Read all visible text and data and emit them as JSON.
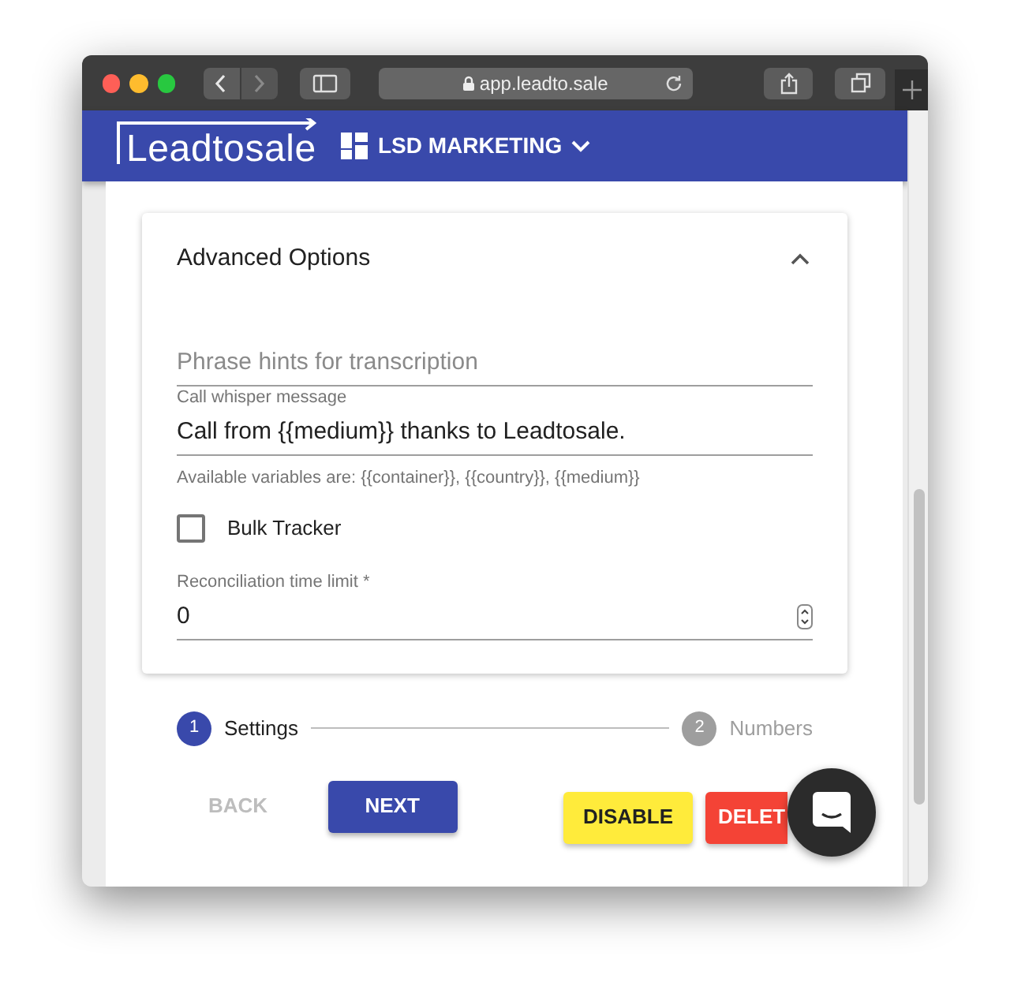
{
  "browser": {
    "url": "app.leadto.sale"
  },
  "header": {
    "logo": "Leadtosale",
    "account": "LSD MARKETING"
  },
  "advanced_options": {
    "title": "Advanced Options",
    "expanded": true,
    "fields": [
      {
        "kind": "text",
        "placeholder": "Phrase hints for transcription"
      },
      {
        "kind": "text",
        "label": "Call whisper message",
        "value": "Call from {{medium}} thanks to Leadtosale.",
        "helper": "Available variables are: {{container}}, {{country}}, {{medium}}"
      },
      {
        "kind": "checkbox",
        "label": "Bulk Tracker",
        "checked": false
      },
      {
        "kind": "number",
        "label": "Reconciliation time limit *",
        "value": "0"
      }
    ]
  },
  "stepper": [
    {
      "number": "1",
      "label": "Settings",
      "selected": true
    },
    {
      "number": "2",
      "label": "Numbers",
      "selected": false
    }
  ],
  "nav_buttons": [
    {
      "kind": "text",
      "label": "BACK",
      "disabled": true
    },
    {
      "kind": "primary",
      "label": "NEXT",
      "disabled": false
    }
  ],
  "action_buttons": [
    {
      "kind": "warning",
      "label": "DISABLE"
    },
    {
      "kind": "danger",
      "label": "DELET"
    }
  ]
}
